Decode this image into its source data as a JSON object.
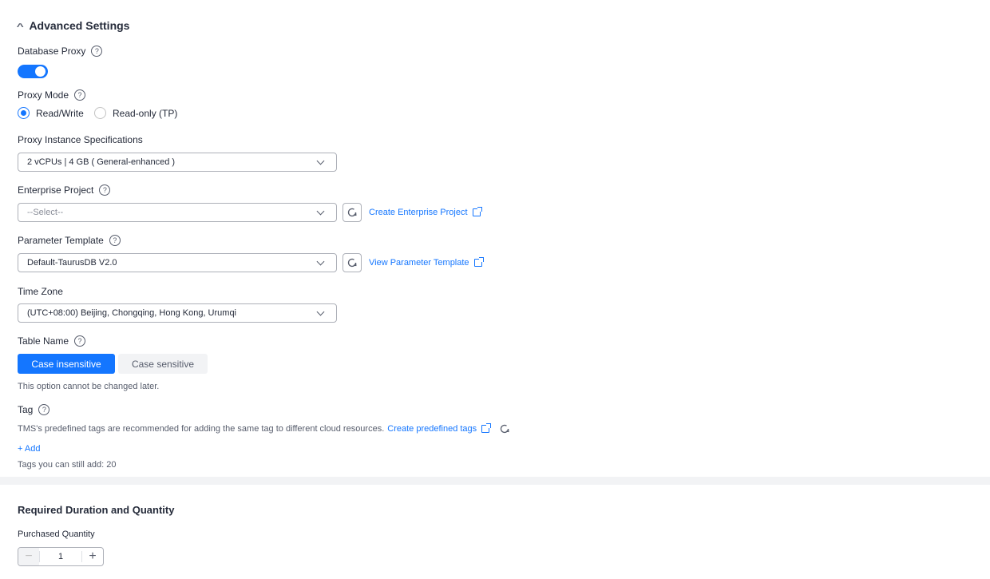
{
  "advanced": {
    "title": "Advanced Settings",
    "db_proxy": {
      "label": "Database Proxy",
      "enabled": true
    },
    "proxy_mode": {
      "label": "Proxy Mode",
      "options": [
        "Read/Write",
        "Read-only (TP)"
      ],
      "selected": "Read/Write"
    },
    "proxy_spec": {
      "label": "Proxy Instance Specifications",
      "value": "2 vCPUs | 4 GB ( General-enhanced )"
    },
    "enterprise_project": {
      "label": "Enterprise Project",
      "placeholder": "--Select--",
      "link": "Create Enterprise Project"
    },
    "param_template": {
      "label": "Parameter Template",
      "value": "Default-TaurusDB V2.0",
      "link": "View Parameter Template"
    },
    "time_zone": {
      "label": "Time Zone",
      "value": "(UTC+08:00) Beijing, Chongqing, Hong Kong, Urumqi"
    },
    "table_name": {
      "label": "Table Name",
      "options": [
        "Case insensitive",
        "Case sensitive"
      ],
      "selected": "Case insensitive",
      "hint": "This option cannot be changed later."
    },
    "tag": {
      "label": "Tag",
      "desc": "TMS's predefined tags are recommended for adding the same tag to different cloud resources.",
      "link": "Create predefined tags",
      "add": "+ Add",
      "remaining": "Tags you can still add: 20"
    }
  },
  "duration": {
    "title": "Required Duration and Quantity",
    "quantity_label": "Purchased Quantity",
    "quantity": "1"
  },
  "colors": {
    "primary": "#1476ff",
    "text": "#252b3a",
    "muted": "#575d6c"
  }
}
